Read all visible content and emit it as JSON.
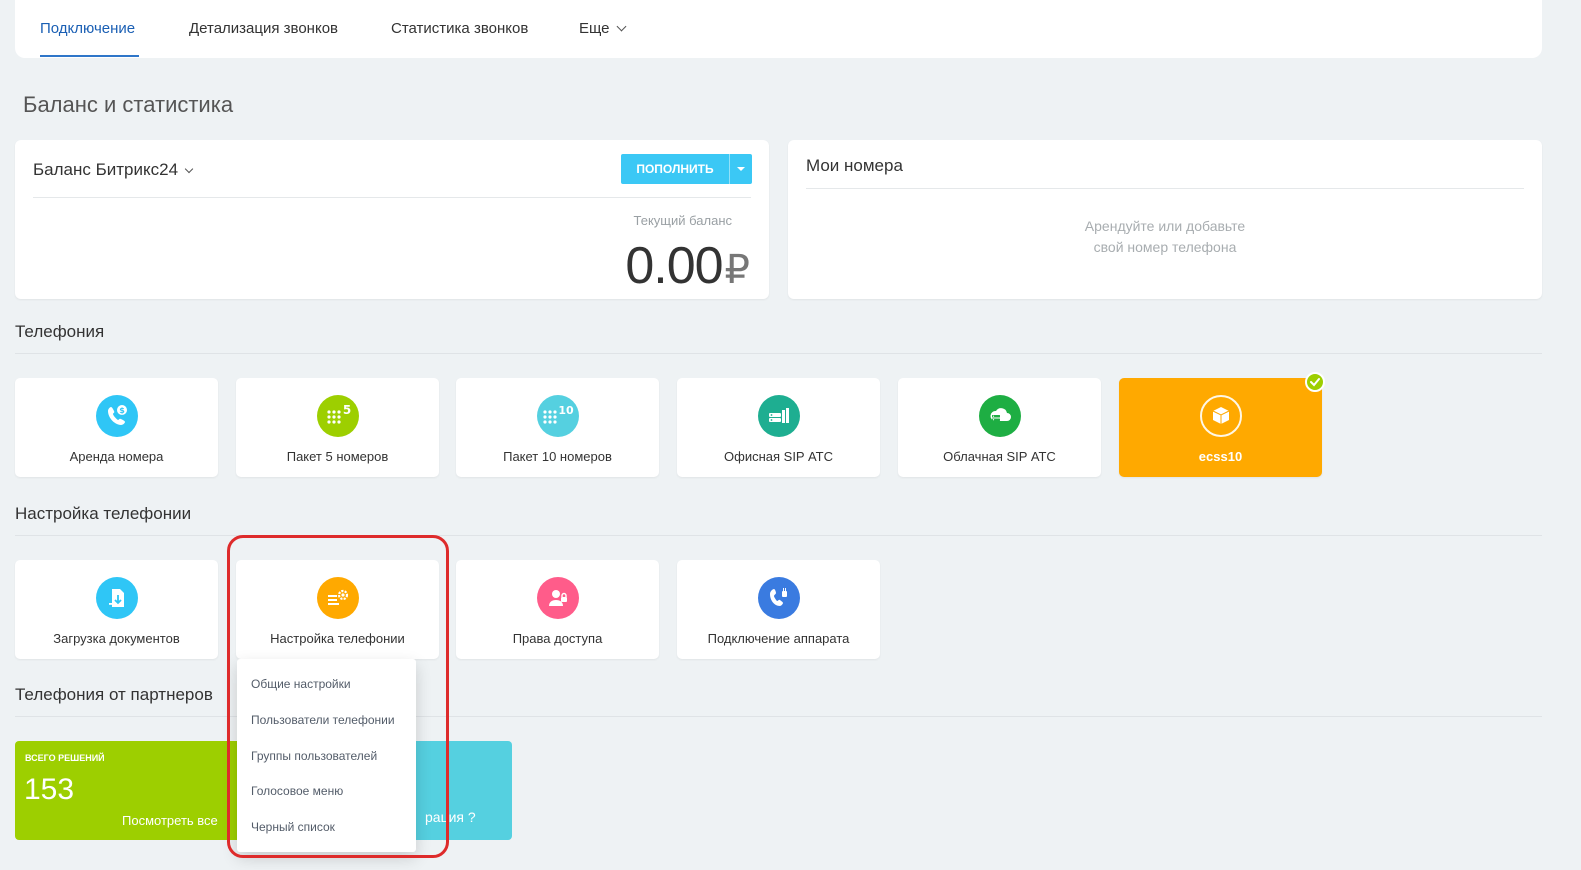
{
  "nav": {
    "tabs": [
      {
        "label": "Подключение",
        "active": true
      },
      {
        "label": "Детализация звонков"
      },
      {
        "label": "Статистика звонков"
      },
      {
        "label": "Еще"
      }
    ]
  },
  "page_title": "Баланс и статистика",
  "balance": {
    "title": "Баланс Битрикс24",
    "topup_label": "ПОПОЛНИТЬ",
    "current_label": "Текущий баланс",
    "amount": "0.00",
    "currency": "₽"
  },
  "numbers": {
    "title": "Мои номера",
    "empty_line1": "Арендуйте или добавьте",
    "empty_line2": "свой номер телефона"
  },
  "telephony": {
    "title": "Телефония",
    "tiles": [
      {
        "label": "Аренда номера",
        "icon": "phone-dollar-icon",
        "color": "#2fc6f6"
      },
      {
        "label": "Пакет 5 номеров",
        "icon": "dialpad-5-icon",
        "color": "#9dcf00"
      },
      {
        "label": "Пакет 10 номеров",
        "icon": "dialpad-10-icon",
        "color": "#55d0e0"
      },
      {
        "label": "Офисная SIP АТС",
        "icon": "office-pbx-icon",
        "color": "#1eae91"
      },
      {
        "label": "Облачная SIP АТС",
        "icon": "cloud-pbx-icon",
        "color": "#1eae43"
      },
      {
        "label": "ecss10",
        "icon": "box-icon",
        "color": "#ffa900",
        "selected": true
      }
    ]
  },
  "settings": {
    "title": "Настройка телефонии",
    "tiles": [
      {
        "label": "Загрузка документов",
        "icon": "document-upload-icon",
        "color": "#2fc6f6"
      },
      {
        "label": "Настройка телефонии",
        "icon": "telephony-settings-icon",
        "color": "#ffa900"
      },
      {
        "label": "Права доступа",
        "icon": "user-lock-icon",
        "color": "#ff5c8a"
      },
      {
        "label": "Подключение аппарата",
        "icon": "phone-plug-icon",
        "color": "#3a7be0"
      }
    ]
  },
  "dropdown": {
    "items": [
      "Общие настройки",
      "Пользователи телефонии",
      "Группы пользователей",
      "Голосовое меню",
      "Черный список"
    ]
  },
  "partners": {
    "title": "Телефония от партнеров",
    "total_label": "ВСЕГО РЕШЕНИЙ",
    "total_count": "153",
    "view_all": "Посмотреть все",
    "cyan_text": "рация ?"
  }
}
